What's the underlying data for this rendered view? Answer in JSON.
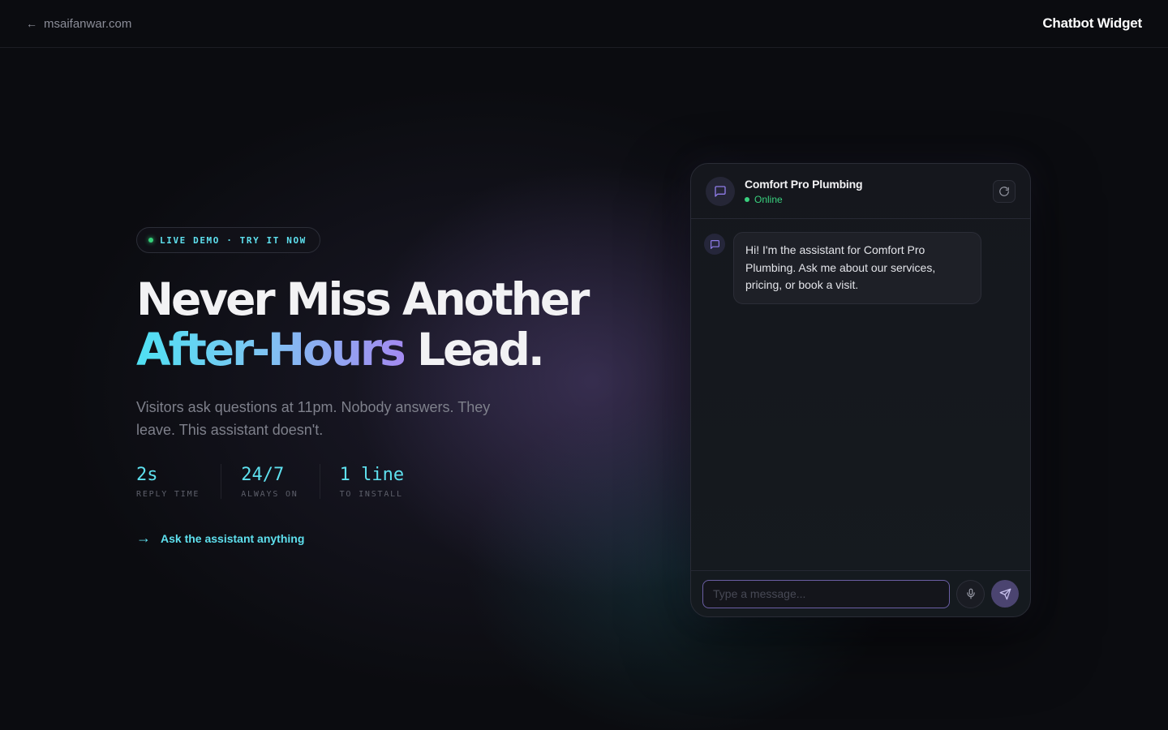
{
  "topbar": {
    "back_arrow": "←",
    "back_link": "msaifanwar.com",
    "brand": "Chatbot Widget"
  },
  "hero": {
    "badge": "LIVE DEMO · TRY IT NOW",
    "headline_line1": "Never Miss Another",
    "headline_line2_gradient": "After-Hours",
    "headline_line2_plain": " Lead.",
    "subtitle": "Visitors ask questions at 11pm. Nobody answers. They leave. This assistant doesn't.",
    "stats": [
      {
        "value": "2s",
        "label": "REPLY TIME"
      },
      {
        "value": "24/7",
        "label": "ALWAYS ON"
      },
      {
        "value": "1 line",
        "label": "TO INSTALL"
      }
    ],
    "cta_arrow": "→",
    "cta": "Ask the assistant anything"
  },
  "chat": {
    "name": "Comfort Pro Plumbing",
    "status": "Online",
    "messages": [
      {
        "from": "bot",
        "text": "Hi! I'm the assistant for Comfort Pro Plumbing. Ask me about our services, pricing, or book a visit."
      }
    ],
    "input_placeholder": "Type a message..."
  },
  "colors": {
    "accent_cyan": "#5ee0ee",
    "accent_purple": "#a38af0",
    "online_green": "#39d07e"
  },
  "icons": {
    "avatar": "chat-bubble-icon",
    "refresh": "refresh-icon",
    "mic": "microphone-icon",
    "send": "send-icon"
  }
}
